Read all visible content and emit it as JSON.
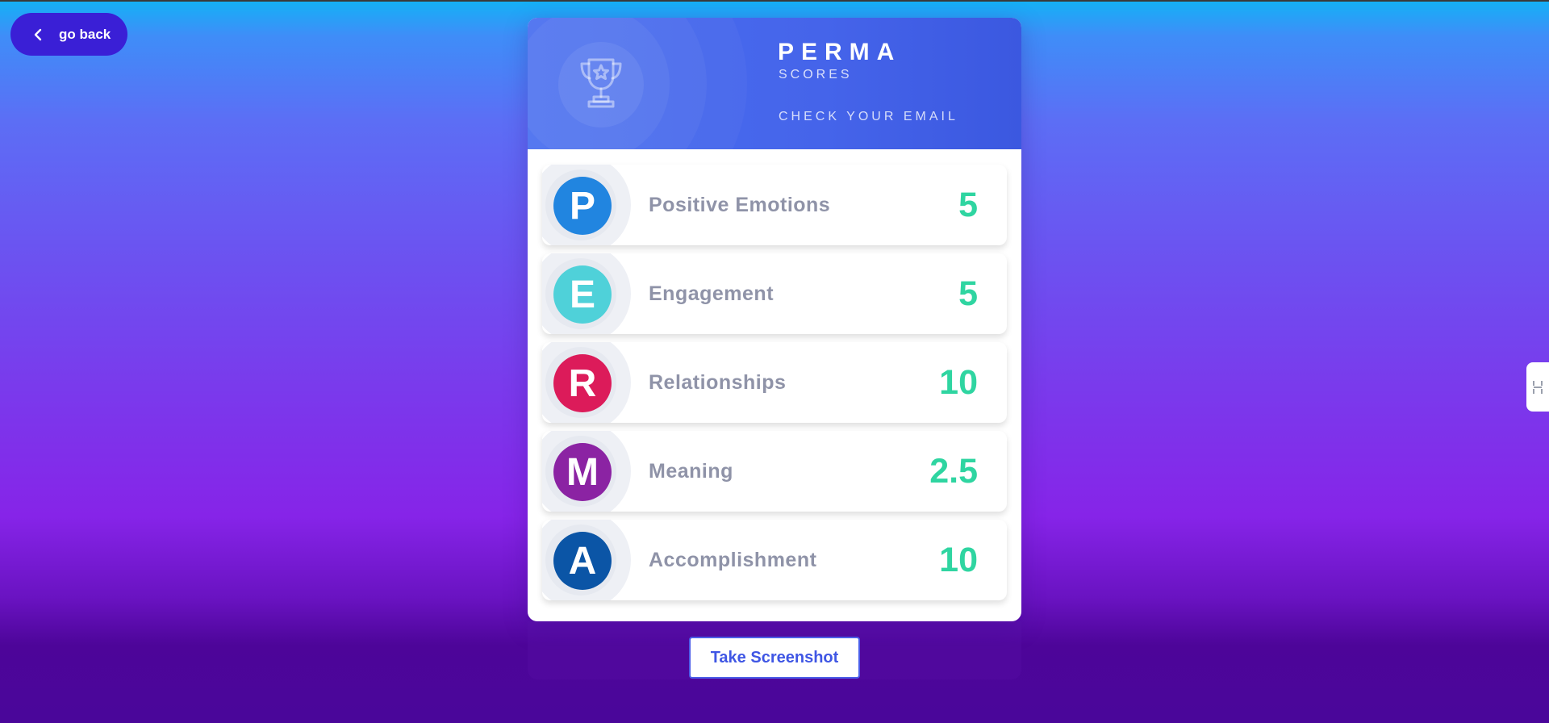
{
  "nav": {
    "back_label": "go back",
    "back_icon": "chevron-left-icon"
  },
  "side_tab": {
    "icon": "sidebar-toggle-icon"
  },
  "header": {
    "title": "PERMA",
    "subtitle": "SCORES",
    "note": "CHECK YOUR EMAIL",
    "icon": "trophy-icon"
  },
  "scores": [
    {
      "letter": "P",
      "label": "Positive Emotions",
      "score": "5",
      "color": "#2185e0"
    },
    {
      "letter": "E",
      "label": "Engagement",
      "score": "5",
      "color": "#4fd1d9"
    },
    {
      "letter": "R",
      "label": "Relationships",
      "score": "10",
      "color": "#dc1b5a"
    },
    {
      "letter": "M",
      "label": "Meaning",
      "score": "2.5",
      "color": "#8b23a3"
    },
    {
      "letter": "A",
      "label": "Accomplishment",
      "score": "10",
      "color": "#0b55a6"
    }
  ],
  "footer": {
    "screenshot_label": "Take Screenshot"
  },
  "colors": {
    "accent": "#3a1fd6",
    "score_text": "#2fd5a1",
    "header_bg": "#4564ea"
  }
}
